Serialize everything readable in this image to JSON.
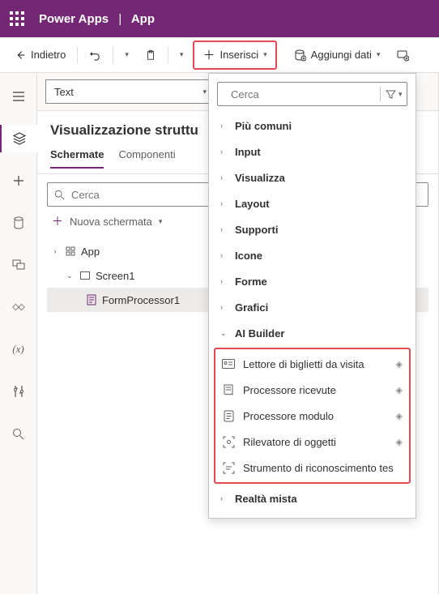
{
  "titlebar": {
    "product": "Power Apps",
    "separator": "|",
    "app": "App"
  },
  "toolbar": {
    "back": "Indietro",
    "insert": "Inserisci",
    "add_data": "Aggiungi dati"
  },
  "formula_bar": {
    "property": "Text"
  },
  "tree_panel": {
    "title": "Visualizzazione struttu",
    "tab_screens": "Schermate",
    "tab_components": "Componenti",
    "search_placeholder": "Cerca",
    "new_screen": "Nuova schermata",
    "nodes": {
      "app": "App",
      "screen1": "Screen1",
      "formproc": "FormProcessor1"
    }
  },
  "flyout": {
    "search_placeholder": "Cerca",
    "categories": {
      "common": "Più comuni",
      "input": "Input",
      "display": "Visualizza",
      "layout": "Layout",
      "media": "Supporti",
      "icons": "Icone",
      "shapes": "Forme",
      "charts": "Grafici",
      "ai": "AI Builder",
      "mixed": "Realtà mista"
    },
    "ai_items": {
      "bcard": "Lettore di biglietti da visita",
      "receipt": "Processore ricevute",
      "form": "Processore modulo",
      "object": "Rilevatore di oggetti",
      "text": "Strumento di riconoscimento tes"
    }
  }
}
